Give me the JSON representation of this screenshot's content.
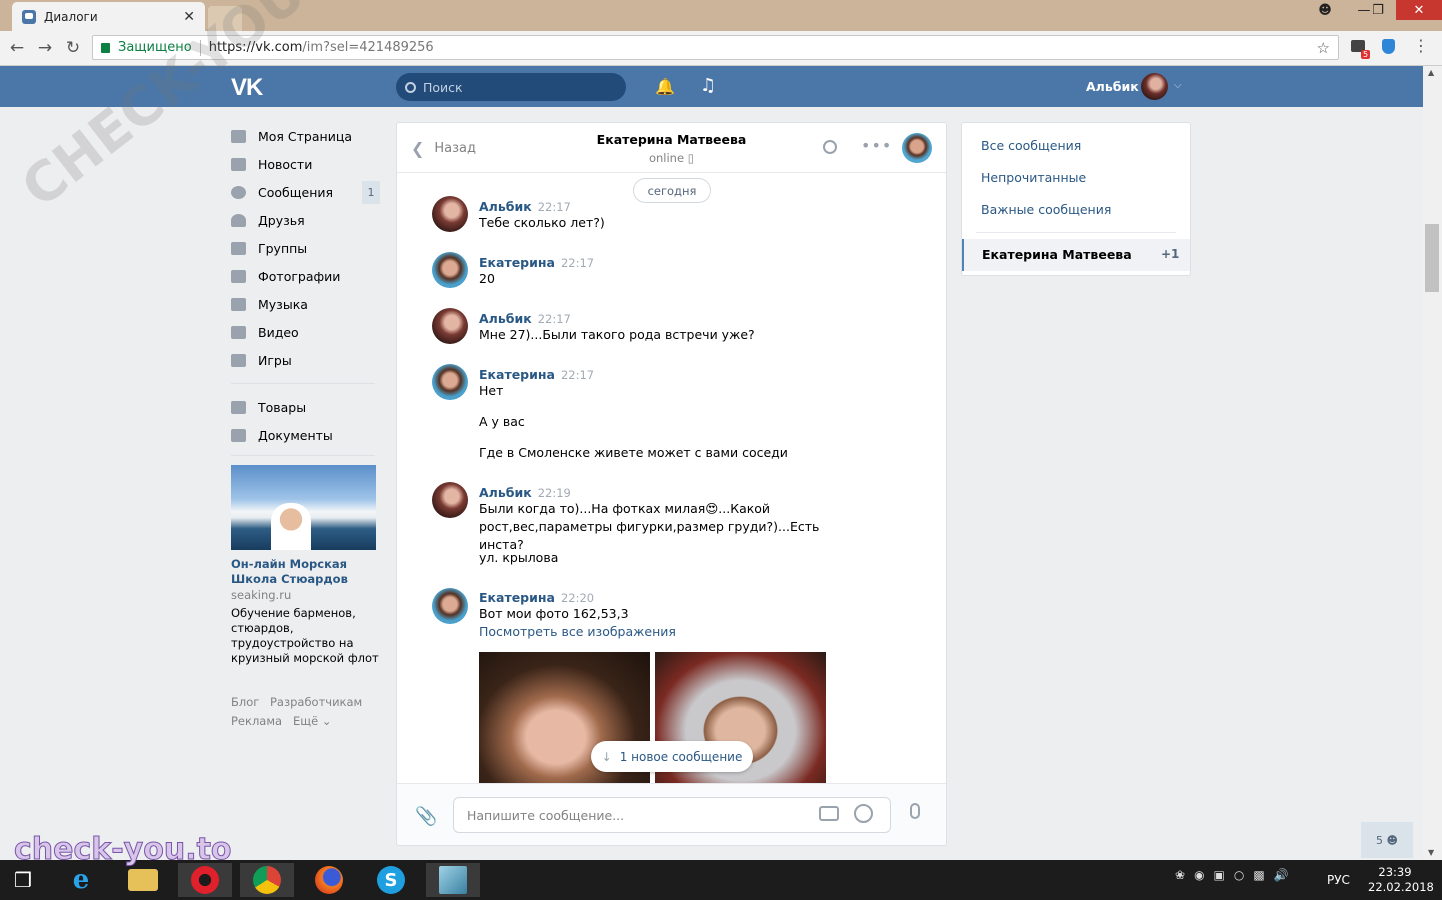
{
  "browser": {
    "tab_title": "Диалоги",
    "tab_close": "✕",
    "secure_label": "Защищено",
    "url_host": "https://vk.com",
    "url_path": "/im?sel=421489256",
    "extension_badge": "5"
  },
  "header": {
    "logo": "VK",
    "search_placeholder": "Поиск",
    "user_name": "Альбик"
  },
  "sidebar": {
    "items": [
      {
        "label": "Моя Страница",
        "icon": "home-icon"
      },
      {
        "label": "Новости",
        "icon": "news-icon"
      },
      {
        "label": "Сообщения",
        "icon": "messages-icon",
        "badge": "1"
      },
      {
        "label": "Друзья",
        "icon": "friends-icon"
      },
      {
        "label": "Группы",
        "icon": "groups-icon"
      },
      {
        "label": "Фотографии",
        "icon": "camera-icon"
      },
      {
        "label": "Музыка",
        "icon": "music-icon"
      },
      {
        "label": "Видео",
        "icon": "video-icon"
      },
      {
        "label": "Игры",
        "icon": "gamepad-icon"
      }
    ],
    "items2": [
      {
        "label": "Товары",
        "icon": "bag-icon"
      },
      {
        "label": "Документы",
        "icon": "document-icon"
      }
    ],
    "ad": {
      "title": "Он-лайн Морская Школа Стюардов",
      "site": "seaking.ru",
      "description": "Обучение барменов, стюардов, трудоустройство на круизный морской флот"
    },
    "footer": {
      "blog": "Блог",
      "developers": "Разработчикам",
      "ads": "Реклама",
      "more": "Ещё ⌄"
    }
  },
  "chat": {
    "back_label": "Назад",
    "peer_name": "Екатерина Матвеева",
    "peer_status": "online",
    "date_divider": "сегодня",
    "messages": [
      {
        "author": "Альбик",
        "time": "22:17",
        "lines": [
          "Тебе сколько лет?)"
        ]
      },
      {
        "author": "Екатерина",
        "time": "22:17",
        "lines": [
          "20"
        ]
      },
      {
        "author": "Альбик",
        "time": "22:17",
        "lines": [
          "Мне 27)...Были такого рода встречи уже?"
        ]
      },
      {
        "author": "Екатерина",
        "time": "22:17",
        "lines": [
          "Нет",
          "А у вас",
          "Где в Смоленске живете может с вами соседи"
        ]
      },
      {
        "author": "Альбик",
        "time": "22:19",
        "lines": [
          "Были когда то)...На фотках милая😍...Какой рост,вес,параметры фигурки,размер груди?)...Есть инста?",
          "ул. крылова"
        ]
      },
      {
        "author": "Екатерина",
        "time": "22:20",
        "lines": [
          "Вот мои фото 162,53,3"
        ],
        "link": "Посмотреть все изображения"
      }
    ],
    "new_message_notice": "1 новое сообщение",
    "input_placeholder": "Напишите сообщение..."
  },
  "right_panel": {
    "links": [
      "Все сообщения",
      "Непрочитанные",
      "Важные сообщения"
    ],
    "selected_dialog": "Екатерина Матвеева",
    "selected_count": "+1"
  },
  "online_friends_count": "5",
  "taskbar": {
    "lang": "РУС",
    "time": "23:39",
    "date": "22.02.2018"
  },
  "watermarks": {
    "diagonal": "CHECK-YOU.ME",
    "corner": "check-you.to"
  },
  "colors": {
    "vk_blue": "#4a76a8",
    "link": "#2a5885",
    "page_bg": "#edeef0"
  }
}
